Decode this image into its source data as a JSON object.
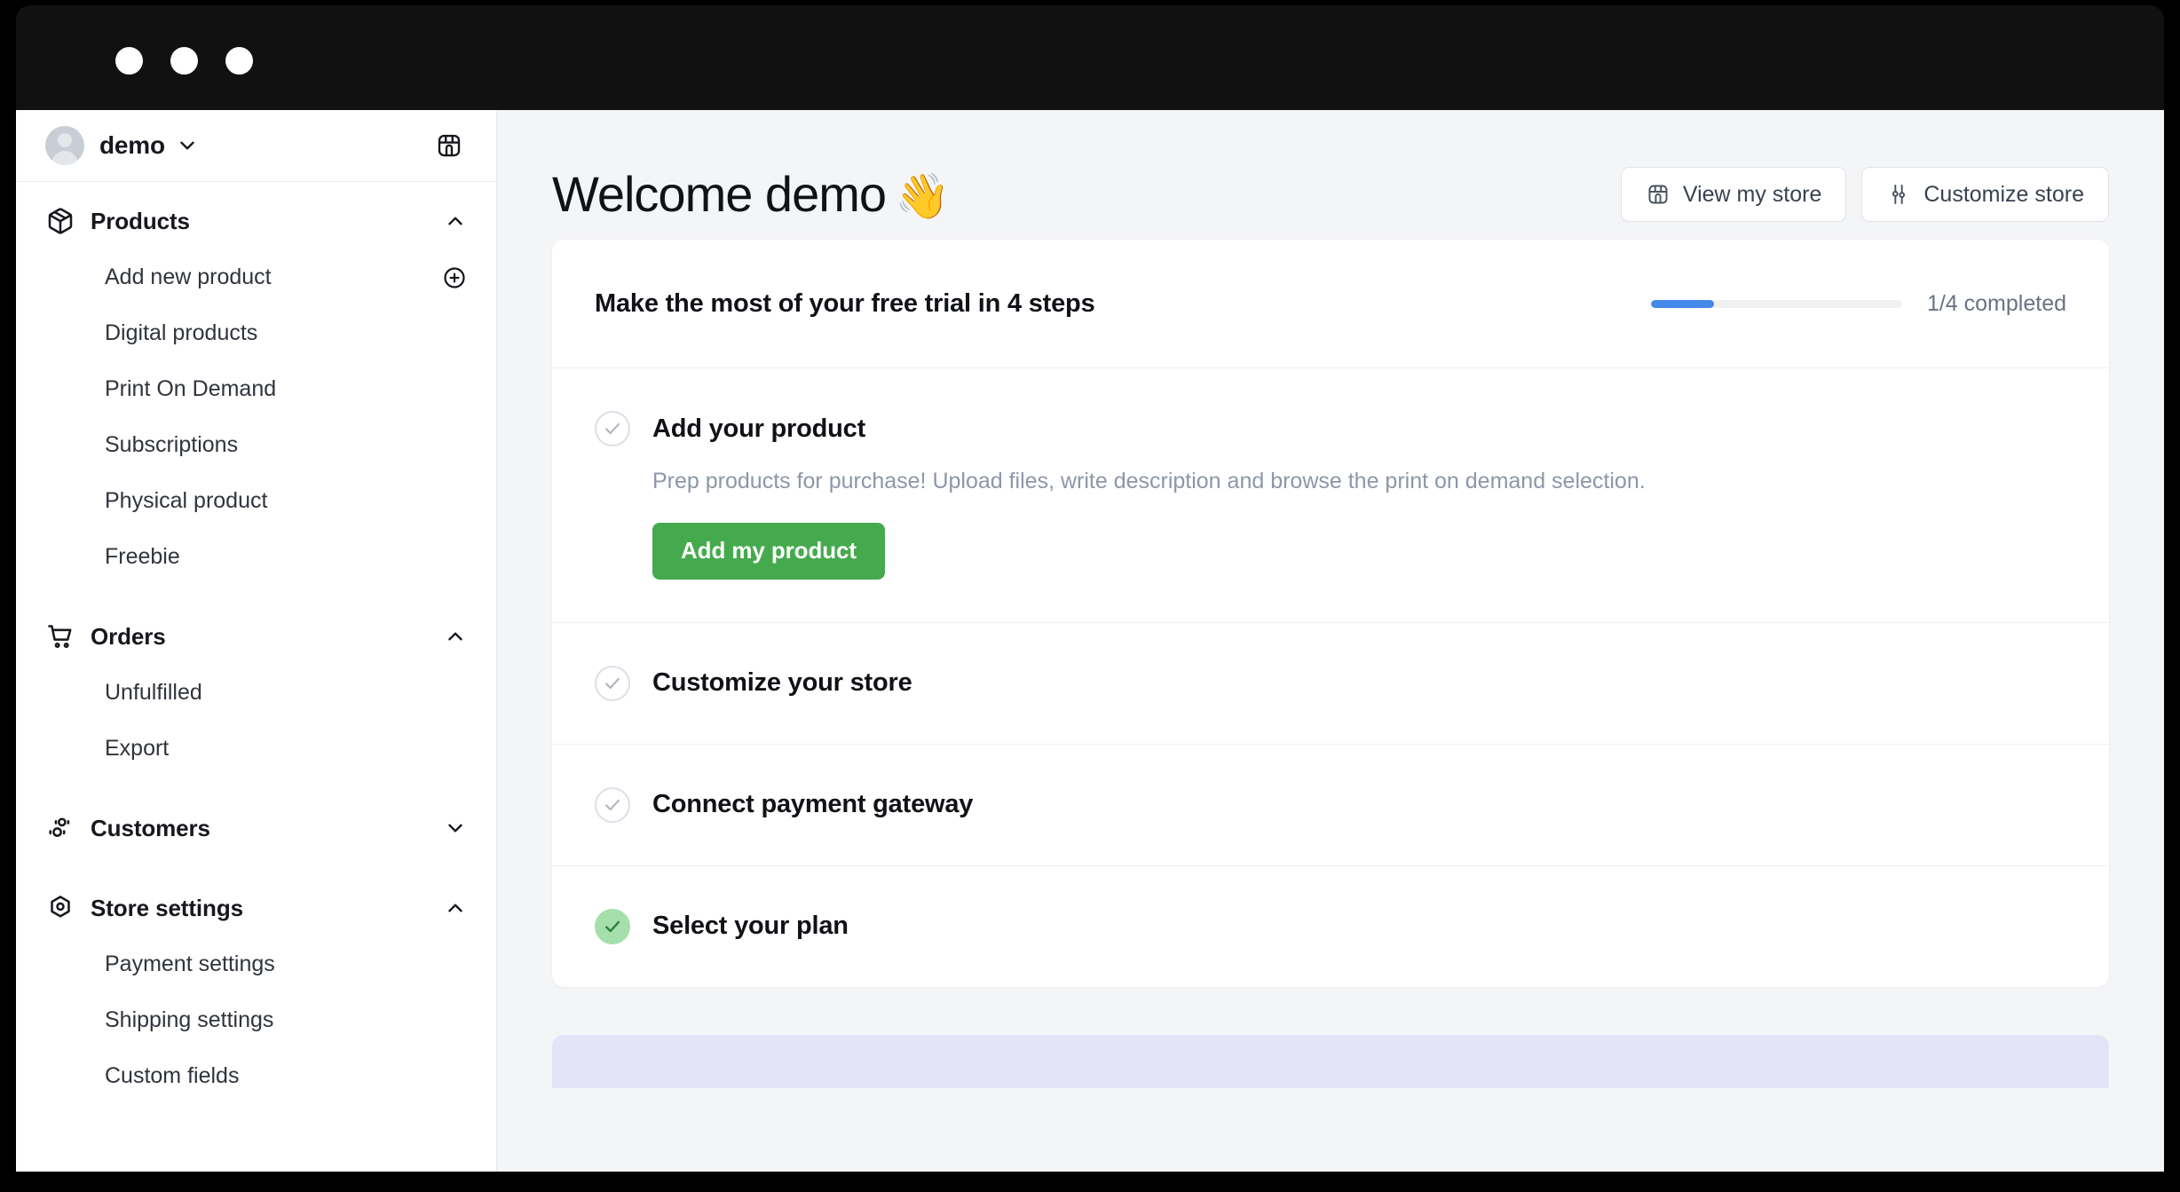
{
  "window": {
    "traffic_lights": [
      "close-dot",
      "minimize-dot",
      "maximize-dot"
    ]
  },
  "sidebar": {
    "account": {
      "name": "demo",
      "avatar_name": "avatar",
      "chevron_icon": "chevron-down-icon",
      "store_icon": "storefront-icon"
    },
    "sections": [
      {
        "label": "Products",
        "icon": "package-icon",
        "chevron": "chevron-up-icon",
        "expanded": true,
        "items": [
          {
            "label": "Add new product",
            "action_icon": "plus-circle-icon"
          },
          {
            "label": "Digital products",
            "action_icon": ""
          },
          {
            "label": "Print On Demand",
            "action_icon": ""
          },
          {
            "label": "Subscriptions",
            "action_icon": ""
          },
          {
            "label": "Physical product",
            "action_icon": ""
          },
          {
            "label": "Freebie",
            "action_icon": ""
          }
        ]
      },
      {
        "label": "Orders",
        "icon": "shopping-cart-icon",
        "chevron": "chevron-up-icon",
        "expanded": true,
        "items": [
          {
            "label": "Unfulfilled",
            "action_icon": ""
          },
          {
            "label": "Export",
            "action_icon": ""
          }
        ]
      },
      {
        "label": "Customers",
        "icon": "users-icon",
        "chevron": "chevron-down-icon",
        "expanded": false,
        "items": []
      },
      {
        "label": "Store settings",
        "icon": "hex-nut-icon",
        "chevron": "chevron-up-icon",
        "expanded": true,
        "items": [
          {
            "label": "Payment settings",
            "action_icon": ""
          },
          {
            "label": "Shipping settings",
            "action_icon": ""
          },
          {
            "label": "Custom fields",
            "action_icon": ""
          }
        ]
      }
    ]
  },
  "header": {
    "title": "Welcome demo",
    "title_emoji": "👋",
    "actions": [
      {
        "label": "View my store",
        "icon": "storefront-icon"
      },
      {
        "label": "Customize store",
        "icon": "sliders-icon"
      }
    ]
  },
  "trial_card": {
    "title": "Make the most of your free trial in 4 steps",
    "progress_label": "1/4 completed",
    "progress_percent": 25,
    "progress_color": "#4687ea",
    "progress_track_color": "#f0f1f3",
    "steps": [
      {
        "title": "Add your product",
        "description": "Prep products for purchase! Upload files, write description and browse the print on demand selection.",
        "cta_label": "Add my product",
        "cta_color": "#45aa4e",
        "completed": false,
        "check_icon": "check-icon"
      },
      {
        "title": "Customize your store",
        "description": "",
        "cta_label": "",
        "completed": false,
        "check_icon": "check-icon"
      },
      {
        "title": "Connect payment gateway",
        "description": "",
        "cta_label": "",
        "completed": false,
        "check_icon": "check-icon"
      },
      {
        "title": "Select your plan",
        "description": "",
        "cta_label": "",
        "completed": true,
        "check_icon": "check-icon"
      }
    ]
  },
  "peek_card": {
    "color": "#e4e4f7"
  }
}
